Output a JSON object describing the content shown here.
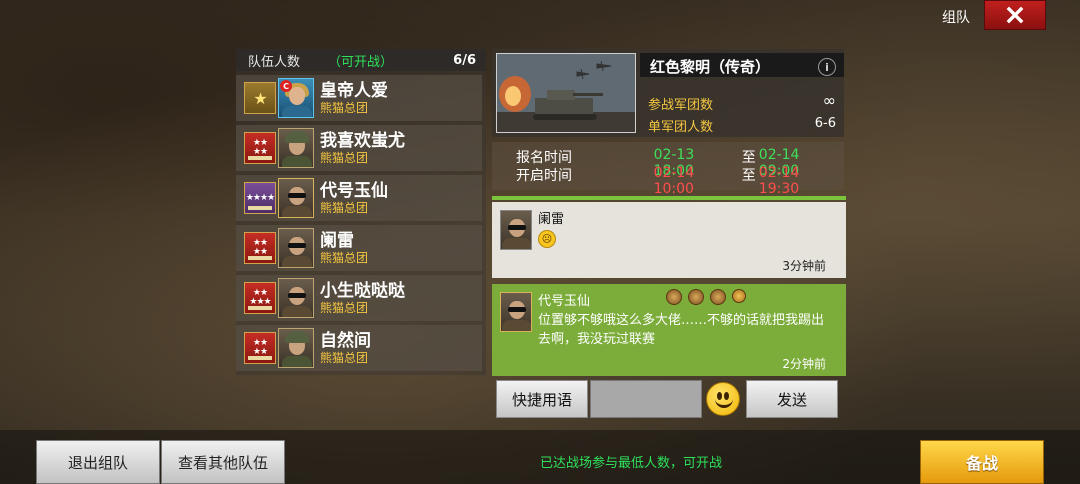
{
  "header": {
    "title": "组队",
    "close_icon": "close-icon"
  },
  "team": {
    "label": "队伍人数",
    "status": "（可开战）",
    "count": "6/6",
    "members": [
      {
        "name": "皇帝人爱",
        "guild": "熊猫总团",
        "rank_color": "gold"
      },
      {
        "name": "我喜欢蚩尤",
        "guild": "熊猫总团",
        "rank_color": "red"
      },
      {
        "name": "代号玉仙",
        "guild": "熊猫总团",
        "rank_color": "purple"
      },
      {
        "name": "阑雷",
        "guild": "熊猫总团",
        "rank_color": "red"
      },
      {
        "name": "小生哒哒哒",
        "guild": "熊猫总团",
        "rank_color": "red"
      },
      {
        "name": "自然间",
        "guild": "熊猫总团",
        "rank_color": "red"
      }
    ]
  },
  "battle": {
    "name": "红色黎明（传奇）",
    "info_icon": "i",
    "legions_label": "参战军团数",
    "legions_value": "∞",
    "per_legion_label": "单军团人数",
    "per_legion_value": "6-6"
  },
  "schedule": {
    "signup_label": "报名时间",
    "signup_start": "02-13 18:00",
    "signup_end": "02-14 09:00",
    "open_label": "开启时间",
    "open_start": "02-14 10:00",
    "open_end": "02-14 19:30",
    "to": "至"
  },
  "chat": {
    "messages": [
      {
        "name": "阑雷",
        "time": "3分钟前"
      },
      {
        "name": "代号玉仙",
        "text": "位置够不够哦这么多大佬……不够的话就把我踢出去啊，我没玩过联赛",
        "time": "2分钟前"
      }
    ],
    "quick_phrase_label": "快捷用语",
    "send_label": "发送"
  },
  "bottom": {
    "leave_label": "退出组队",
    "view_others_label": "查看其他队伍",
    "status_text": "已达战场参与最低人数，可开战",
    "prepare_label": "备战"
  },
  "colors": {
    "accent_green": "#2ee05a",
    "gold_text": "#f4c640",
    "danger": "#ff4d4d",
    "prepare": "#ffd84a"
  }
}
